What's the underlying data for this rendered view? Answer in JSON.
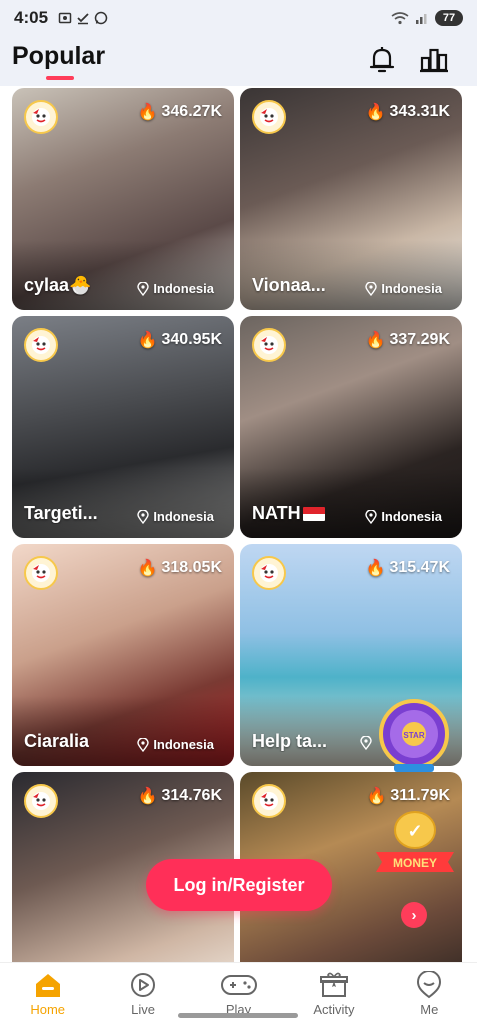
{
  "status": {
    "time": "4:05",
    "battery": "77"
  },
  "header": {
    "title": "Popular"
  },
  "cards": [
    {
      "name": "cylaa🐣",
      "heat": "346.27K",
      "location": "Indonesia",
      "bg": "linear-gradient(160deg,#c9c2b8 0%,#8c7b73 35%,#5b4a48 70%,#d9d5cf 100%)"
    },
    {
      "name": "Vionaa...",
      "heat": "343.31K",
      "location": "Indonesia",
      "bg": "linear-gradient(160deg,#3a3535 0%,#6b5b55 40%,#c9b7a6 70%,#ecebe6 100%)"
    },
    {
      "name": "Targeti...",
      "heat": "340.95K",
      "location": "Indonesia",
      "bg": "linear-gradient(170deg,#7b7f86 0%,#4a4c50 40%,#2a2b2e 65%,#a6a6a4 100%)"
    },
    {
      "name": "NATH",
      "heat": "337.29K",
      "location": "Indonesia",
      "bg": "linear-gradient(160deg,#6c6560 0%,#a08e84 35%,#2b2422 70%,#1c1817 100%)"
    },
    {
      "name": "Ciaralia",
      "heat": "318.05K",
      "location": "Indonesia",
      "bg": "linear-gradient(160deg,#f2d8c9 0%,#caa08b 40%,#7a3a33 70%,#b21f24 100%)"
    },
    {
      "name": "Help ta...",
      "heat": "315.47K",
      "location": "",
      "bg": "linear-gradient(180deg,#bfd7f2 0%,#8fc0e4 40%,#4eb2c9 60%,#e9e3d4 100%)"
    },
    {
      "name": "",
      "heat": "314.76K",
      "location": "",
      "bg": "linear-gradient(160deg,#2a2a30 0%,#6e5a52 40%,#cfb6a4 75%,#efe6dc 100%)"
    },
    {
      "name": "",
      "heat": "311.79K",
      "location": "",
      "bg": "linear-gradient(160deg,#5a4a2a 0%,#b58a54 35%,#6b4a3a 70%,#2b2320 100%)"
    }
  ],
  "login_button": {
    "label": "Log in/Register"
  },
  "money_badge": {
    "label": "MONEY"
  },
  "spin_wheel": {
    "label": "STAR"
  },
  "nav": [
    {
      "label": "Home",
      "icon": "home-icon"
    },
    {
      "label": "Live",
      "icon": "live-icon"
    },
    {
      "label": "Play",
      "icon": "gamepad-icon"
    },
    {
      "label": "Activity",
      "icon": "gift-icon"
    },
    {
      "label": "Me",
      "icon": "profile-icon"
    }
  ],
  "colors": {
    "accent": "#ff2f58",
    "nav_active": "#f5a300",
    "header_bg": "#eef1f8"
  }
}
